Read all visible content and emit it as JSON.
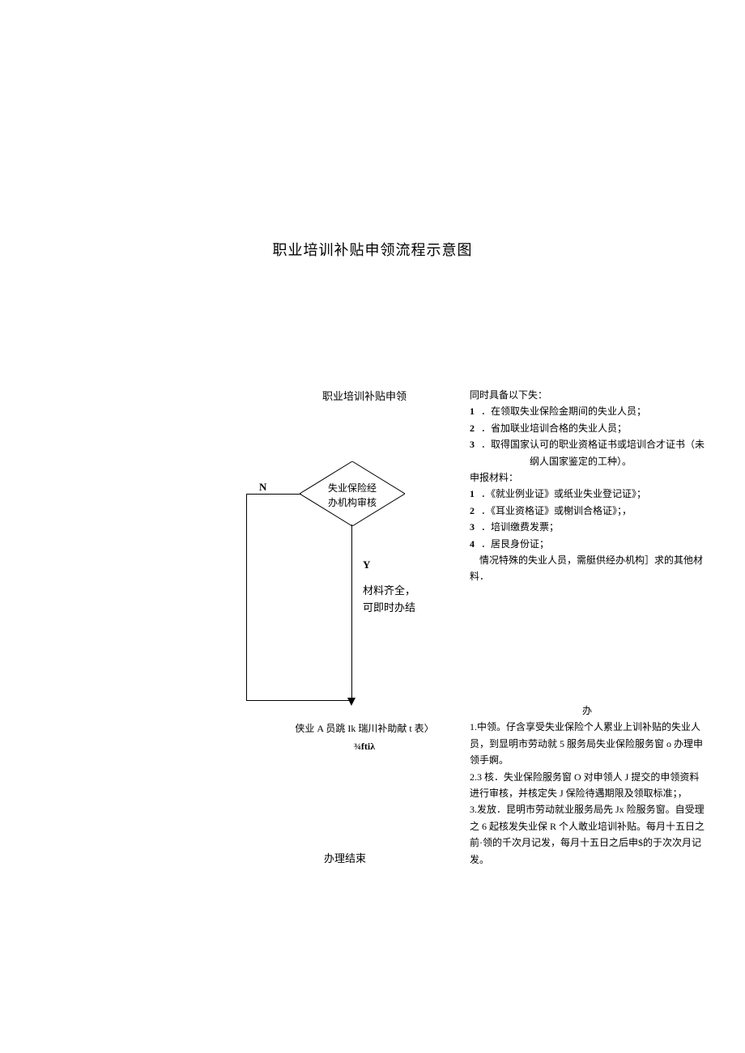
{
  "title": "职业培训补贴申领流程示意图",
  "flow": {
    "start": "职业培训补贴申领",
    "decision": "失业保险经\n办机构审核",
    "no_label": "N",
    "yes_label": "Y",
    "material_ok_line1": "材料齐全，",
    "material_ok_line2": "可即时办结",
    "form_line1": "侠业 A 员跳 Ik 瑞川补助献 t 表〉",
    "form_line2": "¾ftiλ",
    "end": "办理结束"
  },
  "conditions": {
    "heading": "同时具备以下失：",
    "items": [
      {
        "n": "1",
        "t": "．在领取失业保险金期间的失业人员；"
      },
      {
        "n": "2",
        "t": "．省加联业培训合格的失业人员；"
      },
      {
        "n": "3",
        "t": "．取得国家认可的职业资格证书或培训合才证书（未纲人国家鉴定的工种）。"
      }
    ],
    "materials_heading": "申报材料：",
    "materials": [
      {
        "n": "1",
        "t": "．《就业例业证》或纸业失业登记证》；"
      },
      {
        "n": "2",
        "t": "．《耳业资格证》或榭训合格证》；，"
      },
      {
        "n": "3",
        "t": "．培训缴费发票；"
      },
      {
        "n": "4",
        "t": "．居艮身份证；"
      }
    ],
    "special": "情况特殊的失业人员，需艇供经办机构］求的其他材料．"
  },
  "process": {
    "heading": "办",
    "steps": [
      "1.中领。仔含享受失业保险个人累业上训补贴的失业人员，到显明市劳动就 5 服务局失业保险服务窗 o 办理申领手婀。",
      "2.3 核．失业保险服务窗 O 对申领人 J 提交的申领资料进行审核，并核定失 J 保险待遇期限及领取标准；，",
      "3.发放．昆明市劳动就业服务局先 Jx 险服务窗。自受理之 6 起核发失业保 R 个人敢业培训补贴。每月十五日之前·领的千次月记发，每月十五日之后申$的于次次月记发。"
    ]
  }
}
